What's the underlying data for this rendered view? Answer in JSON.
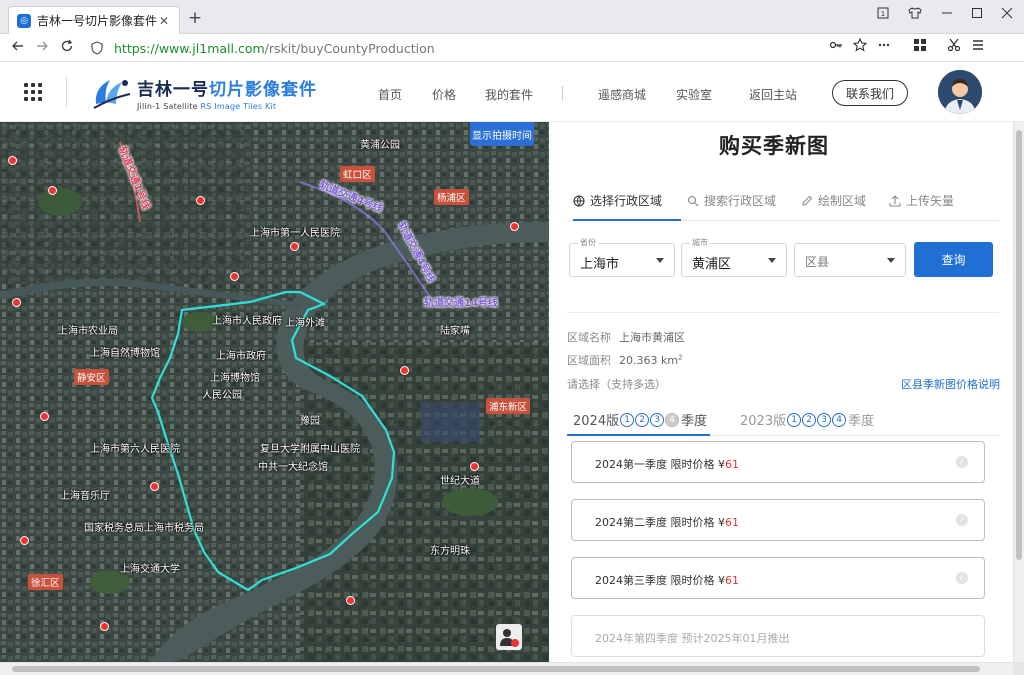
{
  "browser": {
    "tab_title": "吉林一号切片影像套件",
    "url_scheme": "https://",
    "url_host": "www.jl1mall.com",
    "url_path": "/rskit/buyCountyProduction",
    "close_glyph": "✕",
    "new_tab_glyph": "+"
  },
  "site": {
    "brand_cn_1": "吉林一号",
    "brand_cn_2": "切片影像套件",
    "brand_en_1": "Jilin-1 Satellite",
    "brand_en_2": "RS Image Tiles Kit",
    "nav": [
      "首页",
      "价格",
      "我的套件",
      "遥感商城",
      "实验室",
      "返回主站"
    ],
    "contact_label": "联系我们"
  },
  "map": {
    "show_time_button": "显示拍摄时间",
    "labels": [
      "静安区",
      "虹口区",
      "杨浦区",
      "浦东新区",
      "徐汇区",
      "上海市人民政府",
      "上海市政府",
      "上海博物馆",
      "上海自然博物馆",
      "中共一大纪念馆",
      "豫园",
      "上海外滩",
      "复旦大学附属中山医院",
      "上海市第一人民医院",
      "上海市第六人民医院",
      "上海音乐厅",
      "国家税务总局上海市税务局",
      "上海市农业局",
      "人民公园",
      "上海交通大学",
      "东方明珠",
      "陆家嘴",
      "世纪大道",
      "黄浦公园"
    ],
    "rail_labels": [
      "轨道交通4号线",
      "轨道交通4号线",
      "轨道交通14号线",
      "轨道交通1号线"
    ]
  },
  "panel": {
    "title": "购买季新图",
    "tabs": [
      "选择行政区域",
      "搜索行政区域",
      "绘制区域",
      "上传矢量"
    ],
    "province_label": "省份",
    "province_value": "上海市",
    "city_label": "城市",
    "city_value": "黄浦区",
    "county_placeholder": "区县",
    "query_button": "查询",
    "area_name_label": "区域名称",
    "area_name_value": "上海市黄浦区",
    "area_size_label": "区域面积",
    "area_size_value": "20.363 km",
    "area_size_sup": "2",
    "choose_label": "请选择（支持多选）",
    "price_link": "区县季新图价格说明",
    "year_tabs": [
      {
        "label": "2024版",
        "quarters": [
          "1",
          "2",
          "3",
          "4"
        ],
        "suffix": "季度"
      },
      {
        "label": "2023版",
        "quarters": [
          "1",
          "2",
          "3",
          "4"
        ],
        "suffix": "季度"
      }
    ],
    "cards": [
      {
        "title": "2024第一季度 限时价格 ¥",
        "price": "61"
      },
      {
        "title": "2024第二季度 限时价格 ¥",
        "price": "61"
      },
      {
        "title": "2024第三季度 限时价格 ¥",
        "price": "61"
      },
      {
        "title": "2024年第四季度 预计2025年01月推出",
        "price": ""
      }
    ]
  },
  "colors": {
    "accent": "#1f6fd4",
    "price": "#d83a3a",
    "boundary": "#2fe0d6"
  }
}
